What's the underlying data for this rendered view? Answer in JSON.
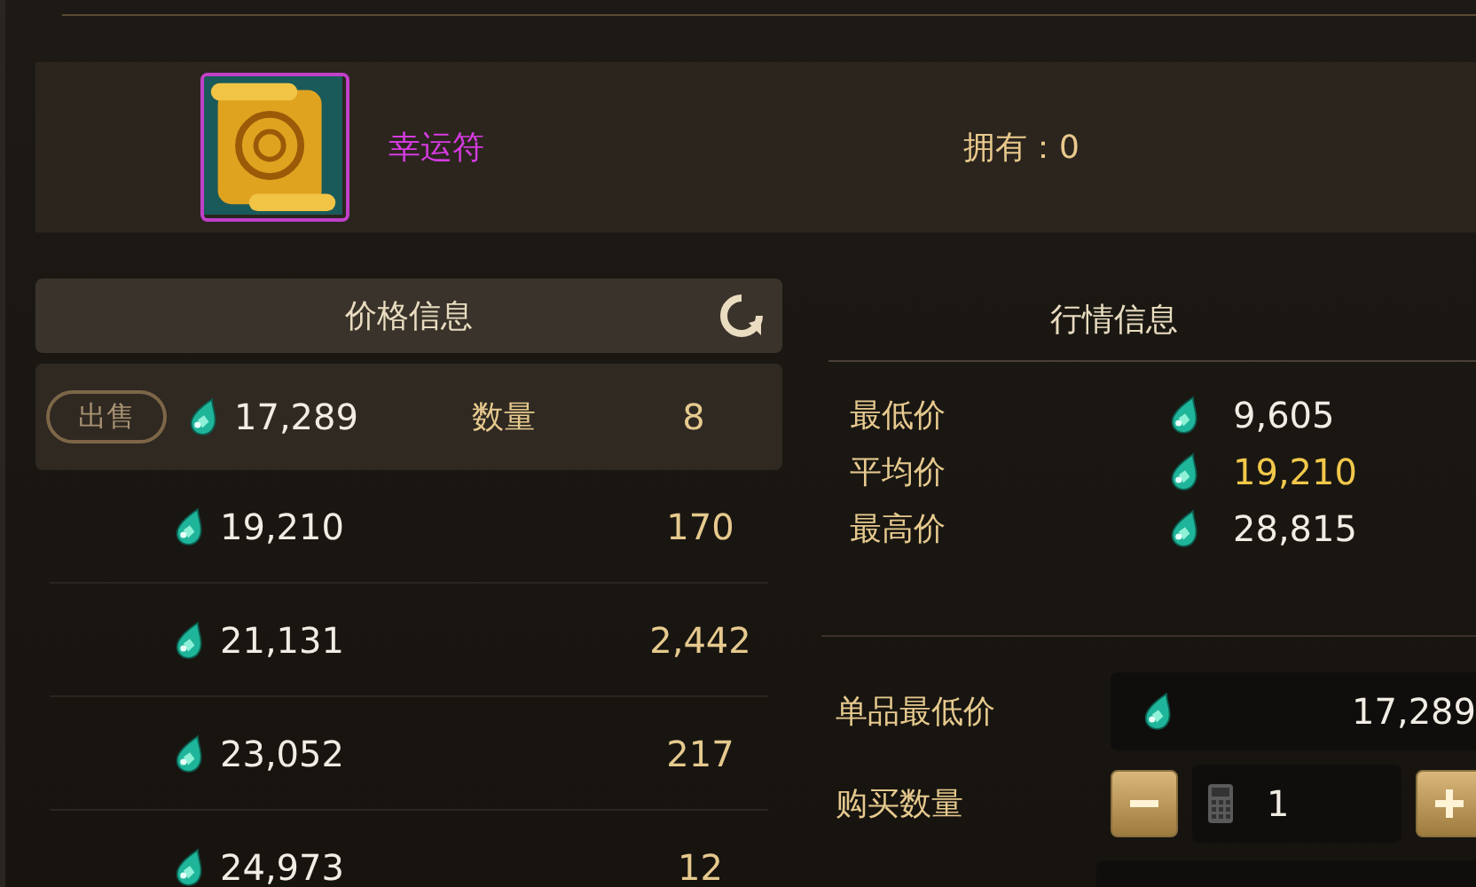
{
  "item": {
    "name": "幸运符",
    "owned_label": "拥有：",
    "owned": "0"
  },
  "price_panel": {
    "title": "价格信息",
    "own_listing": {
      "action": "出售",
      "price": "17,289",
      "qty_label": "数量",
      "qty": "8",
      "selected": true
    },
    "listings": [
      {
        "price": "19,210",
        "qty": "170",
        "selected": false
      },
      {
        "price": "21,131",
        "qty": "2,442",
        "selected": false
      },
      {
        "price": "23,052",
        "qty": "217",
        "selected": false
      },
      {
        "price": "24,973",
        "qty": "12",
        "selected": false
      }
    ]
  },
  "market_panel": {
    "title": "行情信息",
    "stats": [
      {
        "label": "最低价",
        "value": "9,605",
        "highlight": false
      },
      {
        "label": "平均价",
        "value": "19,210",
        "highlight": true
      },
      {
        "label": "最高价",
        "value": "28,815",
        "highlight": false
      }
    ]
  },
  "purchase": {
    "unit_label": "单品最低价",
    "unit_price": "17,289",
    "qty_label": "购买数量",
    "qty": "1"
  }
}
